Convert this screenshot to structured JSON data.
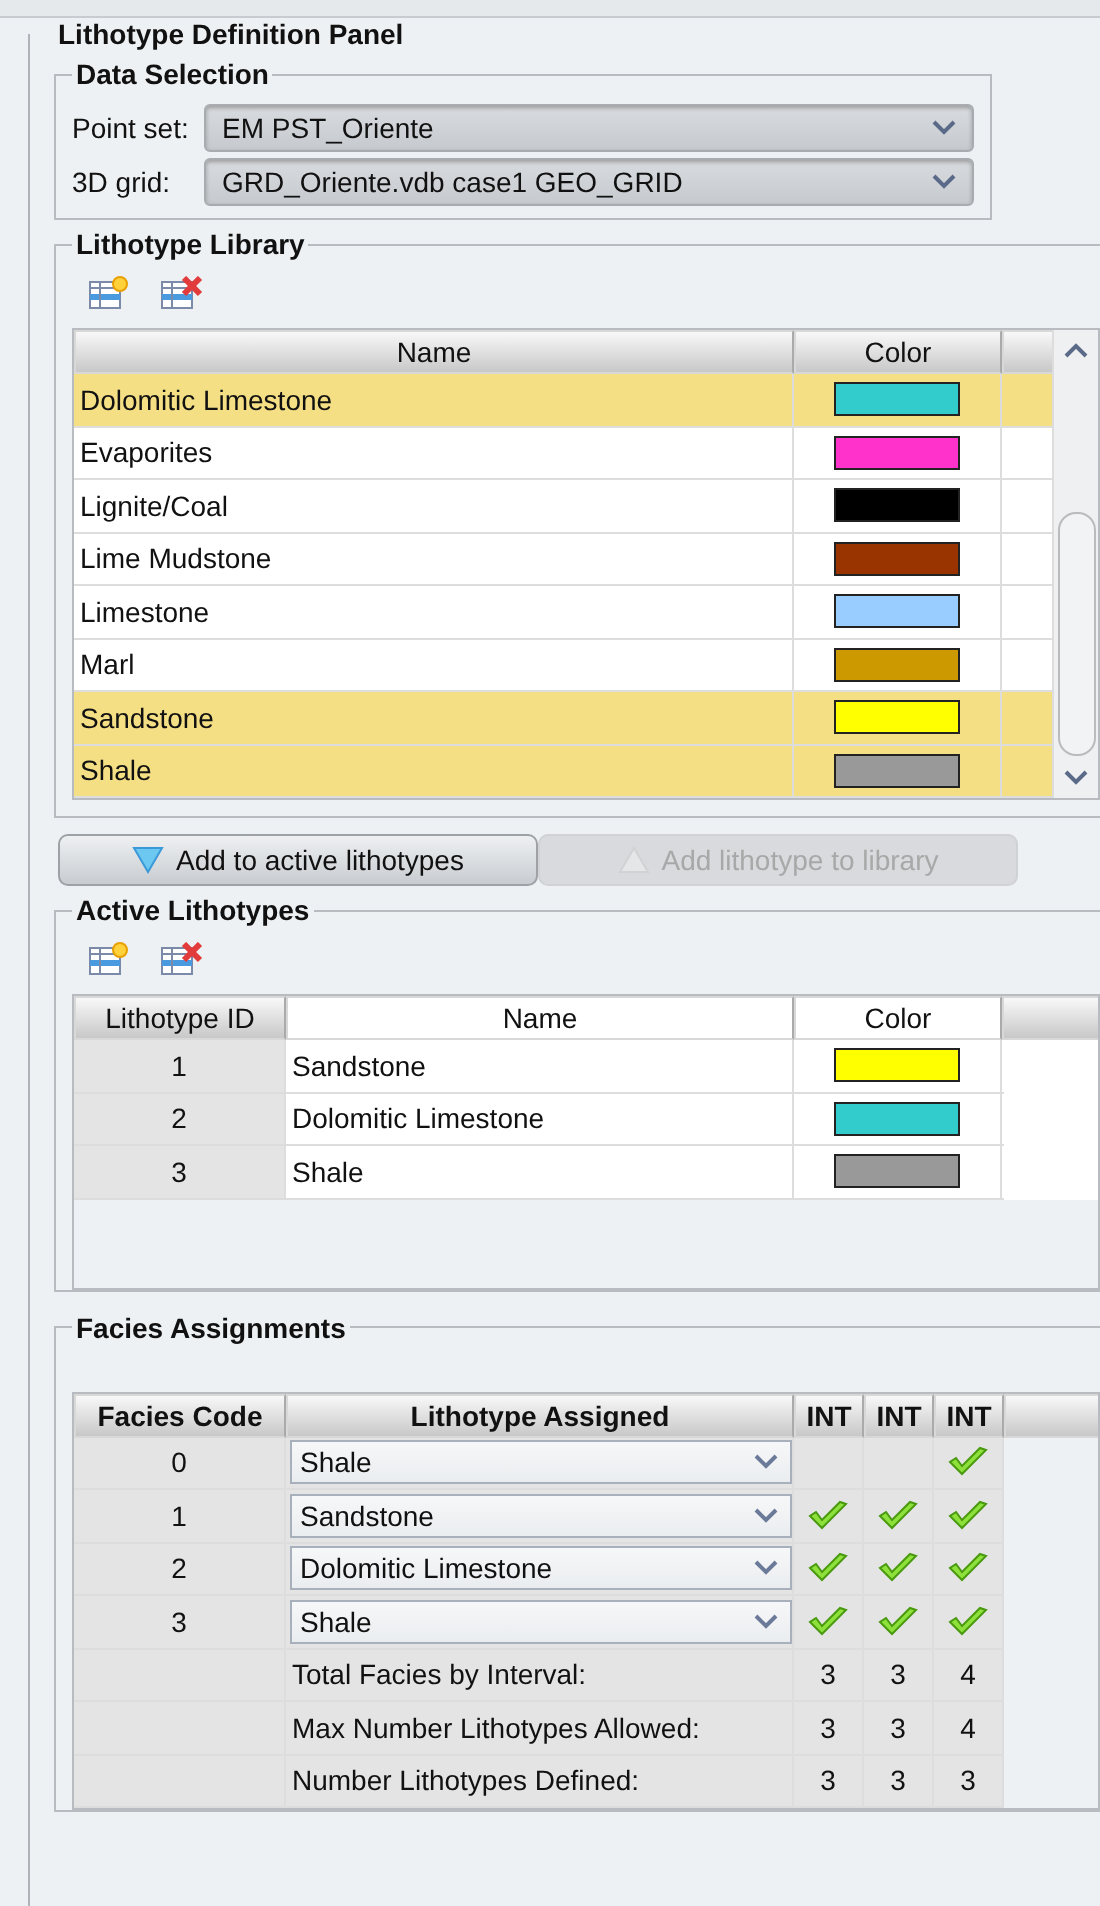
{
  "panel": {
    "title": "Lithotype Definition Panel"
  },
  "data_selection": {
    "title": "Data Selection",
    "fields": [
      {
        "label": "Point set:",
        "value": "EM PST_Oriente"
      },
      {
        "label": "3D grid:",
        "value": "GRD_Oriente.vdb case1 GEO_GRID"
      }
    ]
  },
  "library": {
    "title": "Lithotype Library",
    "columns": [
      "Name",
      "Color"
    ],
    "rows": [
      {
        "name": "Dolomitic Limestone",
        "color": "#33cccc",
        "selected": true
      },
      {
        "name": "Evaporites",
        "color": "#ff33cc",
        "selected": false
      },
      {
        "name": "Lignite/Coal",
        "color": "#000000",
        "selected": false
      },
      {
        "name": "Lime Mudstone",
        "color": "#993300",
        "selected": false
      },
      {
        "name": "Limestone",
        "color": "#99ccff",
        "selected": false
      },
      {
        "name": "Marl",
        "color": "#cc9900",
        "selected": false
      },
      {
        "name": "Sandstone",
        "color": "#ffff00",
        "selected": true
      },
      {
        "name": "Shale",
        "color": "#999999",
        "selected": true
      }
    ]
  },
  "buttons": [
    {
      "label": "Add to active lithotypes",
      "disabled": false,
      "kind": "down"
    },
    {
      "label": "Add lithotype to library",
      "disabled": true,
      "kind": "up"
    }
  ],
  "active": {
    "title": "Active Lithotypes",
    "columns": [
      "Lithotype ID",
      "Name",
      "Color"
    ],
    "rows": [
      {
        "id": "1",
        "name": "Sandstone",
        "color": "#ffff00"
      },
      {
        "id": "2",
        "name": "Dolomitic Limestone",
        "color": "#33cccc"
      },
      {
        "id": "3",
        "name": "Shale",
        "color": "#999999"
      }
    ]
  },
  "facies": {
    "title": "Facies Assignments",
    "columns": [
      "Facies Code",
      "Lithotype Assigned",
      "INT",
      "INT",
      "INT"
    ],
    "rows": [
      {
        "code": "0",
        "lithotype": "Shale",
        "intervals": [
          false,
          false,
          true
        ]
      },
      {
        "code": "1",
        "lithotype": "Sandstone",
        "intervals": [
          true,
          true,
          true
        ]
      },
      {
        "code": "2",
        "lithotype": "Dolomitic Limestone",
        "intervals": [
          true,
          true,
          true
        ]
      },
      {
        "code": "3",
        "lithotype": "Shale",
        "intervals": [
          true,
          true,
          true
        ]
      }
    ],
    "summary": [
      {
        "label": "Total Facies by Interval:",
        "values": [
          "3",
          "3",
          "4"
        ]
      },
      {
        "label": "Max Number Lithotypes Allowed:",
        "values": [
          "3",
          "3",
          "4"
        ]
      },
      {
        "label": "Number Lithotypes Defined:",
        "values": [
          "3",
          "3",
          "3"
        ]
      }
    ]
  }
}
